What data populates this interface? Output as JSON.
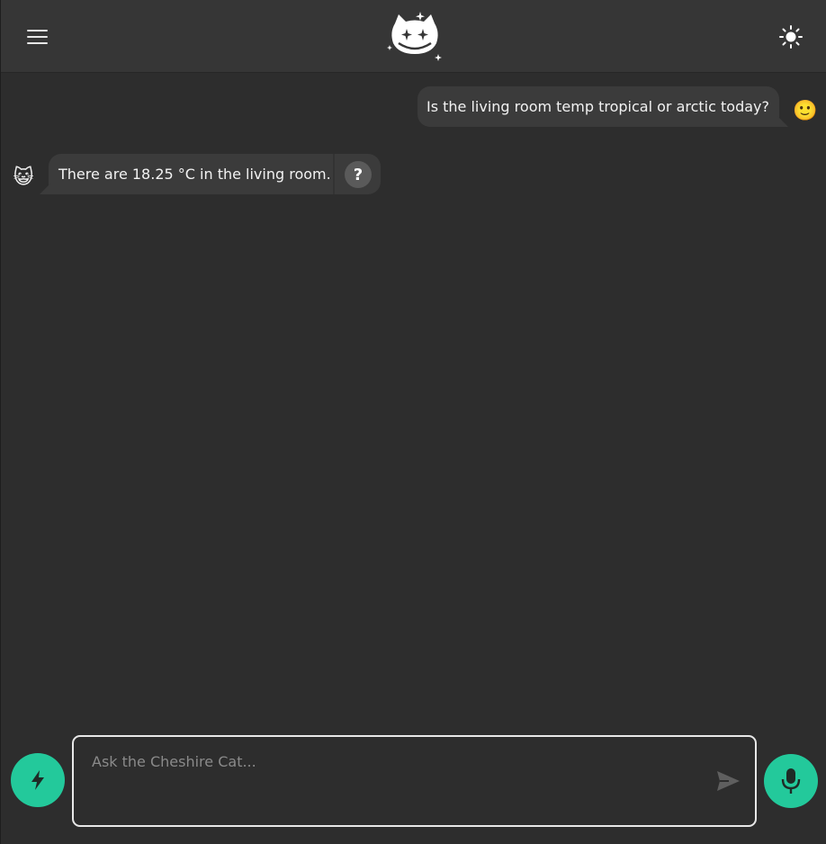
{
  "header": {
    "menu_icon": "hamburger-menu-icon",
    "logo_icon": "cheshire-cat-logo-icon",
    "theme_icon": "sun-icon"
  },
  "messages": [
    {
      "sender": "user",
      "text": "Is the living room temp tropical or arctic today?",
      "avatar": "🙂"
    },
    {
      "sender": "cat",
      "text": "There are 18.25 °C in the living room.",
      "avatar": "😺",
      "why_label": "?"
    }
  ],
  "composer": {
    "placeholder": "Ask the Cheshire Cat...",
    "value": "",
    "left_button_icon": "bolt-icon",
    "send_icon": "send-icon",
    "mic_icon": "microphone-icon"
  },
  "colors": {
    "accent": "#23c99b",
    "background": "#2d2d2d",
    "header": "#363636",
    "bubble": "#3b3b3b"
  }
}
